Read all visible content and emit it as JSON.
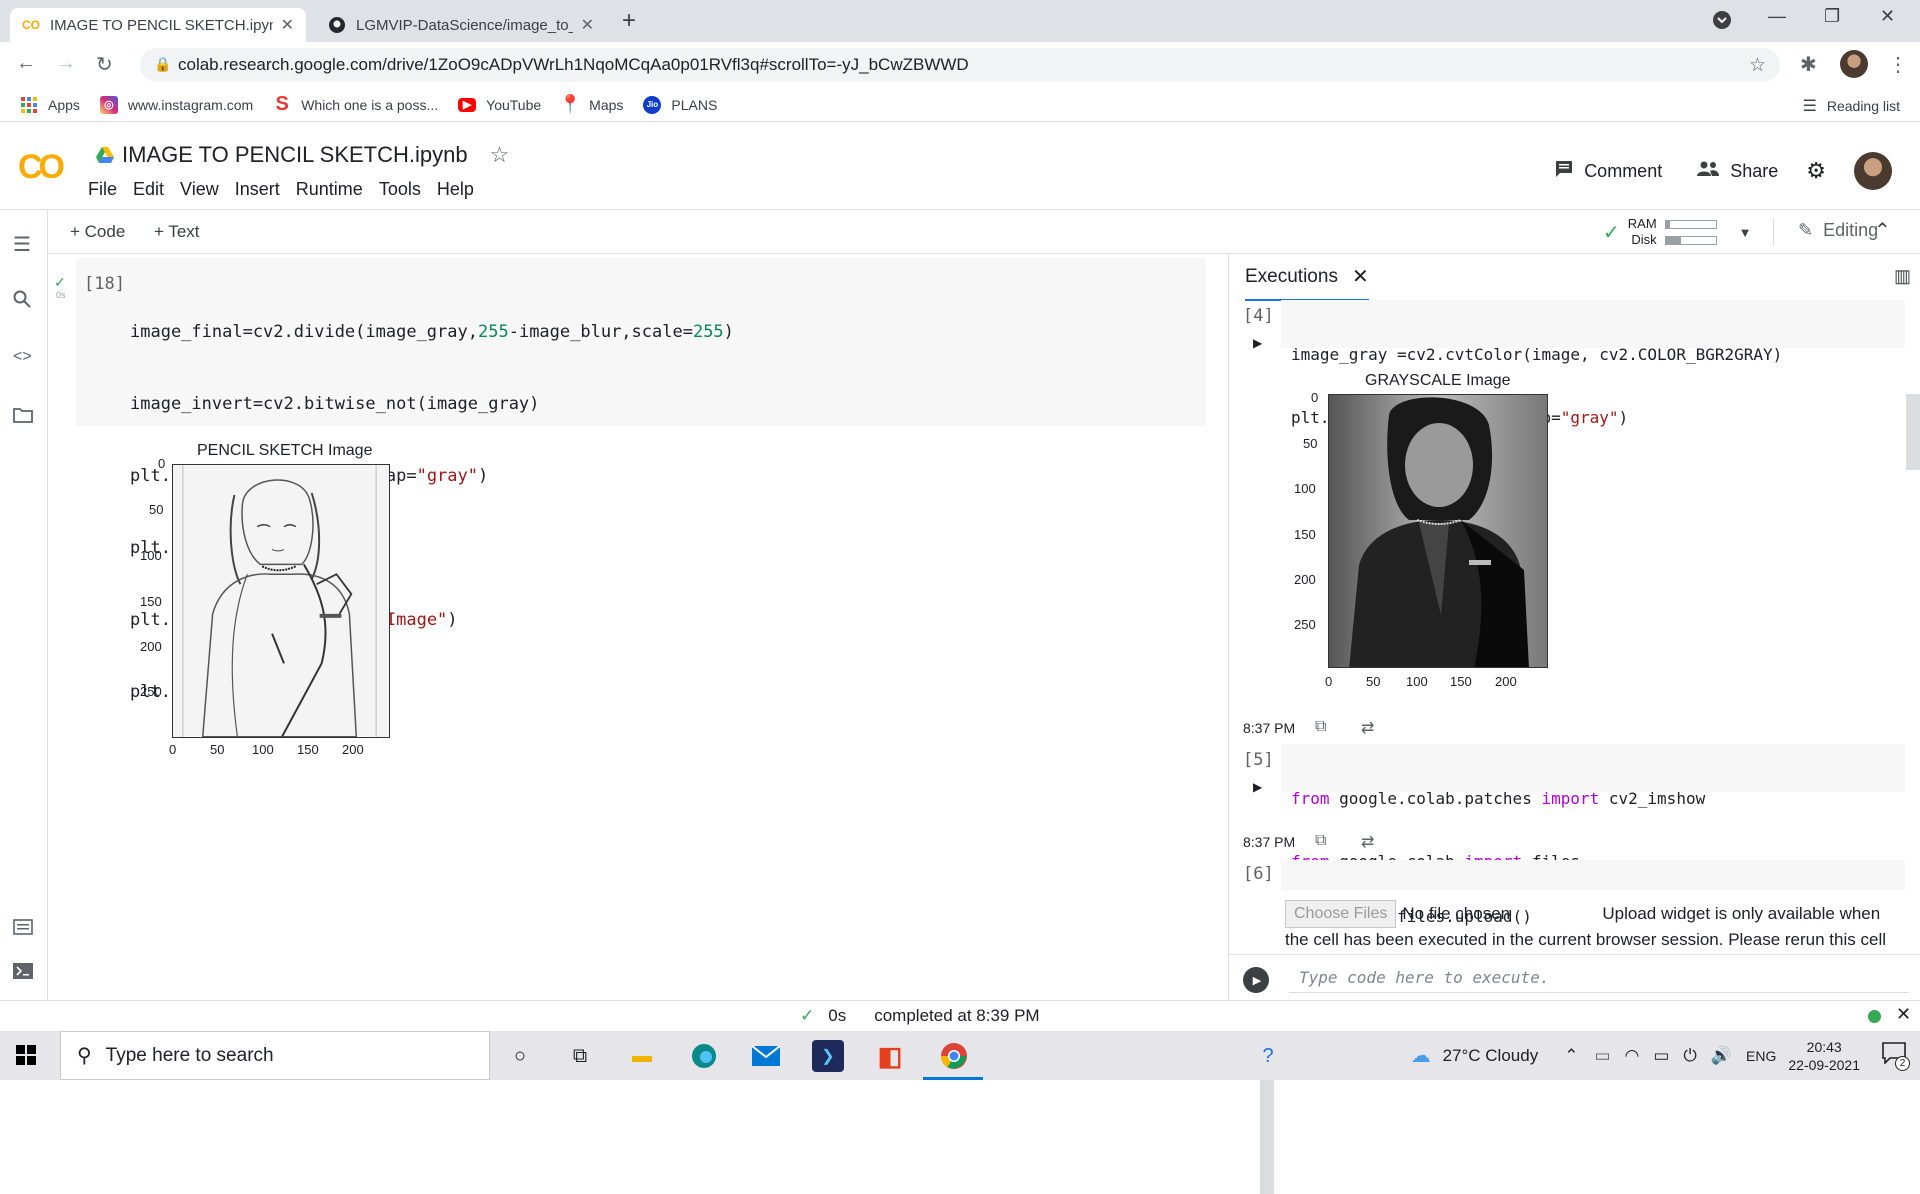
{
  "browser": {
    "tabs": [
      {
        "title": "IMAGE TO PENCIL SKETCH.ipynb",
        "favicon": "colab-icon",
        "active": true
      },
      {
        "title": "LGMVIP-DataScience/image_to_p",
        "favicon": "github-icon",
        "active": false
      }
    ],
    "new_tab_label": "+",
    "url": "colab.research.google.com/drive/1ZoO9cADpVWrLh1NqoMCqAa0p01RVfl3q#scrollTo=-yJ_bCwZBWWD",
    "bookmarks": [
      {
        "label": "Apps",
        "icon": "apps-grid-icon"
      },
      {
        "label": "www.instagram.com",
        "icon": "instagram-icon"
      },
      {
        "label": "Which one is a poss...",
        "icon": "s-logo-icon"
      },
      {
        "label": "YouTube",
        "icon": "youtube-icon"
      },
      {
        "label": "Maps",
        "icon": "maps-pin-icon"
      },
      {
        "label": "PLANS",
        "icon": "jio-icon"
      }
    ],
    "reading_list": "Reading list"
  },
  "colab": {
    "logo": "CO",
    "notebook_title": "IMAGE TO PENCIL SKETCH.ipynb",
    "menu": [
      "File",
      "Edit",
      "View",
      "Insert",
      "Runtime",
      "Tools",
      "Help"
    ],
    "comment_label": "Comment",
    "share_label": "Share",
    "add_code_label": "+ Code",
    "add_text_label": "+ Text",
    "ram_label": "RAM",
    "disk_label": "Disk",
    "ram_fraction": 0.08,
    "disk_fraction": 0.3,
    "editing_label": "Editing"
  },
  "main_cell": {
    "number": "[18]",
    "exec_time": "0s",
    "code_lines": [
      "image_final=cv2.divide(image_gray,255-image_blur,scale=255)",
      "image_invert=cv2.bitwise_not(image_gray)",
      "plt.imshow(image_final,cmap=\"gray\")",
      "plt.grid(False)",
      "plt.title(\"PENCIL SKETCH Image\")",
      "plt.show()"
    ],
    "plot_title": "PENCIL SKETCH Image",
    "y_ticks": [
      "0",
      "50",
      "100",
      "150",
      "200",
      "250"
    ],
    "x_ticks": [
      "0",
      "50",
      "100",
      "150",
      "200"
    ]
  },
  "executions": {
    "tab_label": "Executions",
    "cells": [
      {
        "number": "[4]",
        "code_lines": [
          "image_gray =cv2.cvtColor(image, cv2.COLOR_BGR2GRAY)",
          "plt.imshow(image_gray, cmap=\"gray\")"
        ],
        "plot_title": "GRAYSCALE Image",
        "y_ticks": [
          "0",
          "50",
          "100",
          "150",
          "200",
          "250"
        ],
        "x_ticks": [
          "0",
          "50",
          "100",
          "150",
          "200"
        ],
        "time": "8:37 PM"
      },
      {
        "number": "[5]",
        "code_lines": [
          "from google.colab.patches import cv2_imshow",
          "from google.colab import files"
        ],
        "time": "8:37 PM"
      },
      {
        "number": "[6]",
        "code_lines": [
          "uploaded = files.upload()"
        ]
      }
    ],
    "choose_files": "Choose Files",
    "no_file": "No file chosen",
    "upload_message_1": "Upload widget is only available when",
    "upload_message_2": "the cell has been executed in the current browser session. Please rerun this cell",
    "input_placeholder": "Type code here to execute."
  },
  "status": {
    "exec_time": "0s",
    "completed": "completed at 8:39 PM"
  },
  "taskbar": {
    "search_placeholder": "Type here to search",
    "weather": "27°C  Cloudy",
    "lang": "ENG",
    "time": "20:43",
    "date": "22-09-2021",
    "notifications": "2"
  }
}
